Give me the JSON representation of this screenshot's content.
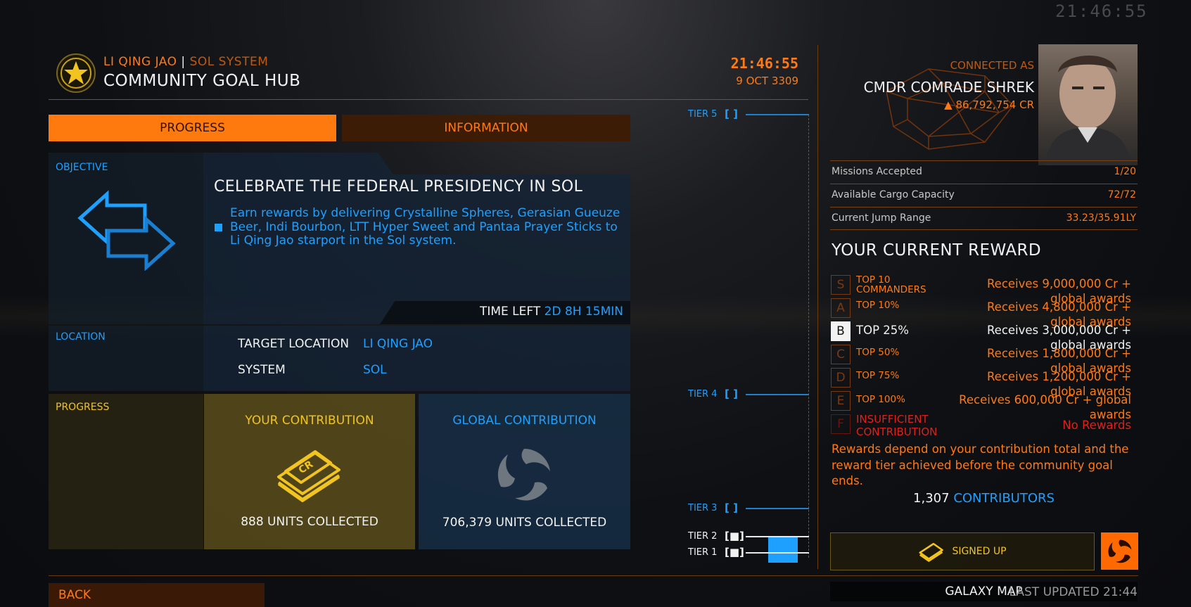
{
  "header": {
    "station": "LI QING JAO",
    "separator": "|",
    "system": "SOL SYSTEM",
    "title": "COMMUNITY GOAL HUB",
    "time": "21:46:55",
    "date": "9 OCT 3309",
    "bg_clock": "21:46:55"
  },
  "tabs": [
    {
      "label": "PROGRESS",
      "active": true
    },
    {
      "label": "INFORMATION",
      "active": false
    }
  ],
  "objective": {
    "section_label": "OBJECTIVE",
    "title": "CELEBRATE THE FEDERAL PRESIDENCY IN SOL",
    "description": "Earn rewards by delivering Crystalline Spheres, Gerasian Gueuze Beer, Indi Bourbon, LTT Hyper Sweet and Pantaa Prayer Sticks to Li Qing Jao starport in the Sol system.",
    "time_left_label": "TIME LEFT",
    "time_left_value": "2D 8H 15MIN"
  },
  "location": {
    "section_label": "LOCATION",
    "target_label": "TARGET LOCATION",
    "target_value": "LI QING JAO",
    "system_label": "SYSTEM",
    "system_value": "SOL"
  },
  "progress": {
    "section_label": "PROGRESS",
    "your_title": "YOUR CONTRIBUTION",
    "your_icon_text": "CR",
    "your_units": "888 UNITS COLLECTED",
    "global_title": "GLOBAL CONTRIBUTION",
    "global_units": "706,379 UNITS COLLECTED"
  },
  "tiers": [
    {
      "label": "TIER 5",
      "bracket": "[ ]"
    },
    {
      "label": "TIER 4",
      "bracket": "[ ]"
    },
    {
      "label": "TIER 3",
      "bracket": "[ ]"
    },
    {
      "label": "TIER 2",
      "bracket": "[■]"
    },
    {
      "label": "TIER 1",
      "bracket": "[■]"
    }
  ],
  "commander": {
    "connected_as": "CONNECTED AS",
    "name": "CMDR COMRADE SHREK",
    "credits": "86,792,754 CR"
  },
  "stats": [
    {
      "label": "Missions Accepted",
      "value": "1/20"
    },
    {
      "label": "Available Cargo Capacity",
      "value": "72/72"
    },
    {
      "label": "Current Jump Range",
      "value": "33.23/35.91LY"
    }
  ],
  "reward": {
    "title": "YOUR CURRENT REWARD",
    "rows": [
      {
        "badge": "S",
        "tier": "TOP 10 COMMANDERS",
        "text": "Receives 9,000,000 Cr + global awards"
      },
      {
        "badge": "A",
        "tier": "TOP 10%",
        "text": "Receives 4,800,000 Cr + global awards"
      },
      {
        "badge": "B",
        "tier": "TOP 25%",
        "text": "Receives 3,000,000 Cr + global awards"
      },
      {
        "badge": "C",
        "tier": "TOP 50%",
        "text": "Receives 1,800,000 Cr + global awards"
      },
      {
        "badge": "D",
        "tier": "TOP 75%",
        "text": "Receives 1,200,000 Cr + global awards"
      },
      {
        "badge": "E",
        "tier": "TOP 100%",
        "text": "Receives 600,000 Cr + global awards"
      },
      {
        "badge": "F",
        "tier": "INSUFFICIENT CONTRIBUTION",
        "text": "No Rewards"
      }
    ],
    "current_badge": "B",
    "note": "Rewards depend on your contribution total and the reward tier achieved before the community goal ends."
  },
  "contributors": {
    "count": "1,307",
    "label": "CONTRIBUTORS"
  },
  "buttons": {
    "signed_up": "SIGNED UP",
    "back": "BACK",
    "galaxy_map": "GALAXY MAP",
    "last_updated": "LAST UPDATED 21:44"
  },
  "colors": {
    "accent": "#ff7a14",
    "highlight": "#1ea0ff",
    "contribution_gold": "#f2c420",
    "insufficient": "#e0201a"
  }
}
